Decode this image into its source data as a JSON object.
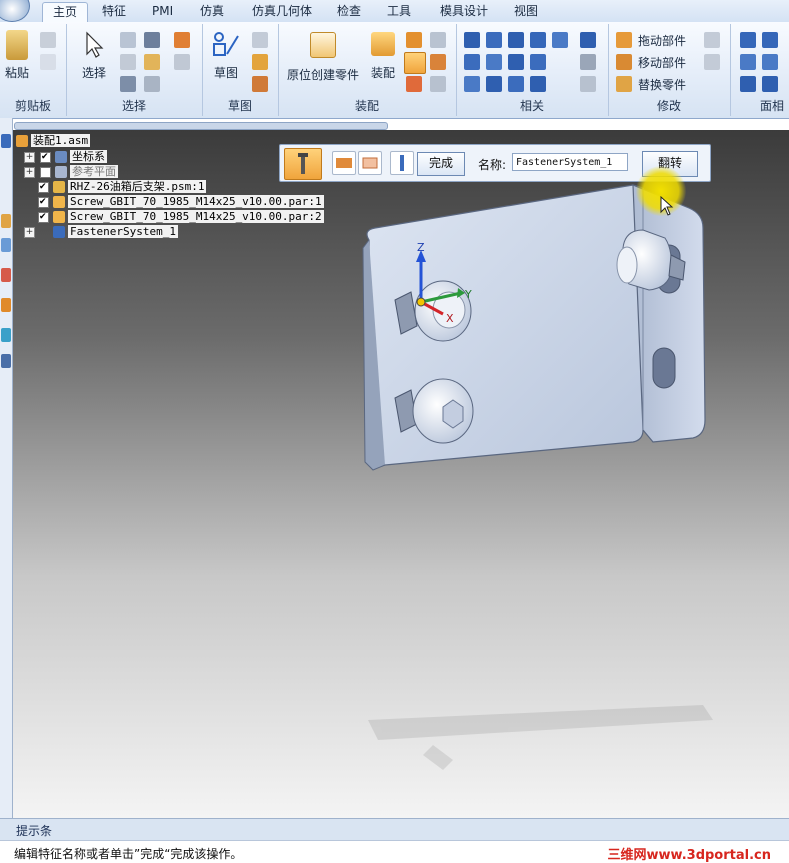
{
  "ribbon": {
    "tabs": [
      "主页",
      "特征",
      "PMI",
      "仿真",
      "仿真几何体",
      "检查",
      "工具",
      "模具设计",
      "视图"
    ],
    "active_tab": "主页",
    "groups": {
      "clipboard": {
        "label": "剪贴板",
        "paste": "粘贴"
      },
      "select": {
        "label": "选择",
        "select_tool": "选择"
      },
      "sketch": {
        "label": "草图",
        "sketch": "草图"
      },
      "assemble": {
        "label": "装配",
        "create_in_place": "原位创建零件",
        "assemble": "装配"
      },
      "relate": {
        "label": "相关"
      },
      "modify": {
        "label": "修改",
        "drag_part": "拖动部件",
        "move_part": "移动部件",
        "replace_part": "替换零件"
      },
      "face_relate": {
        "label": "面相"
      }
    }
  },
  "tree": {
    "root": "装配1.asm",
    "items": [
      {
        "label": "坐标系",
        "checked": true,
        "expandable": true
      },
      {
        "label": "参考平面",
        "checked": false,
        "expandable": true,
        "dim": true
      },
      {
        "label": "RHZ-26油箱后支架.psm:1",
        "checked": true,
        "expandable": false
      },
      {
        "label": "Screw_GBIT_70_1985_M14x25_v10.00.par:1",
        "checked": true,
        "expandable": false
      },
      {
        "label": "Screw_GBIT_70_1985_M14x25_v10.00.par:2",
        "checked": true,
        "expandable": false
      },
      {
        "label": "FastenerSystem_1",
        "checked": null,
        "expandable": true
      }
    ]
  },
  "command_bar": {
    "done": "完成",
    "name_label": "名称:",
    "name_value": "FastenerSystem_1",
    "flip": "翻转"
  },
  "hint_bar": {
    "title": "提示条"
  },
  "status": {
    "text": "编辑特征名称或者单击”完成“完成该操作。",
    "watermark": "三维网www.3dportal.cn"
  },
  "axis_labels": {
    "z": "Z",
    "y": "Y",
    "x": "X"
  },
  "colors": {
    "accent_orange": "#f0a43c",
    "cursor_highlight": "#f2e000",
    "part_steel": "#c9d4e6",
    "watermark_red": "#d7261e"
  }
}
